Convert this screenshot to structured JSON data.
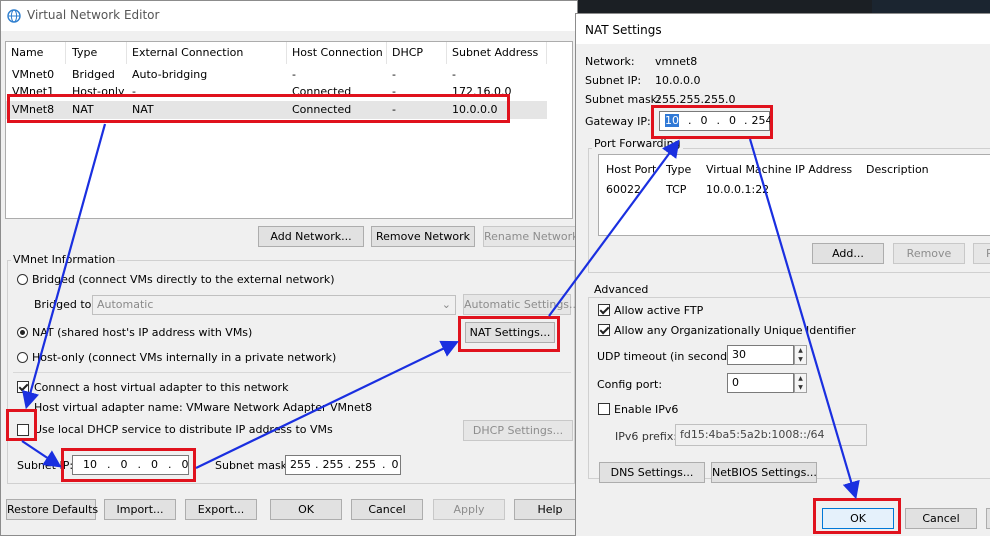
{
  "vne": {
    "title": "Virtual Network Editor",
    "columns": [
      "Name",
      "Type",
      "External Connection",
      "Host Connection",
      "DHCP",
      "Subnet Address"
    ],
    "rows": [
      [
        "VMnet0",
        "Bridged",
        "Auto-bridging",
        "-",
        "-",
        "-"
      ],
      [
        "VMnet1",
        "Host-only",
        "-",
        "Connected",
        "-",
        "172.16.0.0"
      ],
      [
        "VMnet8",
        "NAT",
        "NAT",
        "Connected",
        "-",
        "10.0.0.0"
      ]
    ],
    "buttons": {
      "add_network": "Add Network...",
      "remove_network": "Remove Network",
      "rename_network": "Rename Network..."
    },
    "info_label": "VMnet Information",
    "bridged_label": "Bridged (connect VMs directly to the external network)",
    "bridged_to_label": "Bridged to:",
    "bridged_to_value": "Automatic",
    "auto_settings": "Automatic Settings...",
    "nat_label": "NAT (shared host's IP address with VMs)",
    "nat_settings": "NAT Settings...",
    "hostonly_label": "Host-only (connect VMs internally in a private network)",
    "connect_adapter": "Connect a host virtual adapter to this network",
    "adapter_name": "Host virtual adapter name: VMware Network Adapter VMnet8",
    "dhcp_label": "Use local DHCP service to distribute IP address to VMs",
    "dhcp_settings": "DHCP Settings...",
    "subnet_ip_label": "Subnet IP:",
    "subnet_ip": [
      "10",
      "0",
      "0",
      "0"
    ],
    "subnet_mask_label": "Subnet mask:",
    "subnet_mask": [
      "255",
      "255",
      "255",
      "0"
    ],
    "footer": {
      "restore": "Restore Defaults",
      "import": "Import...",
      "export": "Export...",
      "ok": "OK",
      "cancel": "Cancel",
      "apply": "Apply",
      "help": "Help"
    }
  },
  "nat": {
    "title": "NAT Settings",
    "network_label": "Network:",
    "network": "vmnet8",
    "subnet_ip_label": "Subnet IP:",
    "subnet_ip": "10.0.0.0",
    "subnet_mask_label": "Subnet mask:",
    "subnet_mask": "255.255.255.0",
    "gateway_label": "Gateway IP:",
    "gateway": [
      "10",
      "0",
      "0",
      "254"
    ],
    "port_forwarding_label": "Port Forwarding",
    "pf_columns": [
      "Host Port",
      "Type",
      "Virtual Machine IP Address",
      "Description"
    ],
    "pf_rows": [
      [
        "60022",
        "TCP",
        "10.0.0.1:22",
        ""
      ]
    ],
    "pf_buttons": {
      "add": "Add...",
      "remove": "Remove",
      "properties": "P"
    },
    "advanced_label": "Advanced",
    "allow_ftp": "Allow active FTP",
    "allow_oui": "Allow any Organizationally Unique Identifier",
    "udp_label": "UDP timeout (in seconds):",
    "udp_value": "30",
    "config_port_label": "Config port:",
    "config_port_value": "0",
    "ipv6_label": "Enable IPv6",
    "ipv6_prefix_label": "IPv6 prefix:",
    "ipv6_prefix": "fd15:4ba5:5a2b:1008::/64",
    "dns_settings": "DNS Settings...",
    "netbios_settings": "NetBIOS Settings...",
    "ok": "OK",
    "cancel": "Cancel"
  },
  "colors": {
    "annotation_red": "#e0121d",
    "annotation_arrow": "#1a2fe0",
    "selection": "#e5e5e5"
  }
}
